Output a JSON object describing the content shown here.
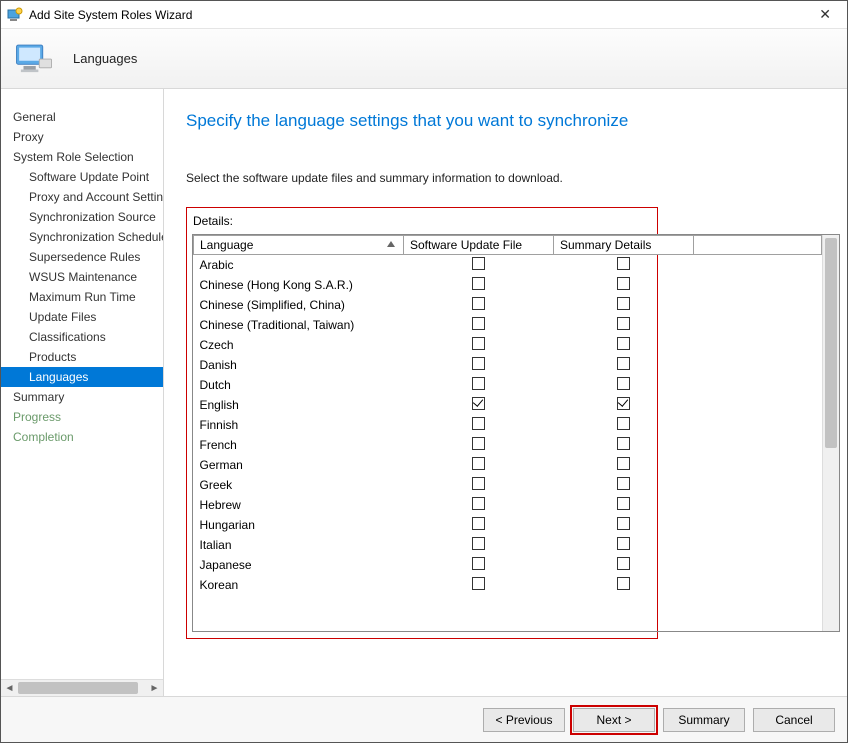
{
  "window": {
    "title": "Add Site System Roles Wizard"
  },
  "header": {
    "title": "Languages"
  },
  "sidebar": {
    "items": [
      {
        "label": "General",
        "child": false,
        "selected": false,
        "disabled": false
      },
      {
        "label": "Proxy",
        "child": false,
        "selected": false,
        "disabled": false
      },
      {
        "label": "System Role Selection",
        "child": false,
        "selected": false,
        "disabled": false
      },
      {
        "label": "Software Update Point",
        "child": true,
        "selected": false,
        "disabled": false
      },
      {
        "label": "Proxy and Account Settings",
        "child": true,
        "selected": false,
        "disabled": false
      },
      {
        "label": "Synchronization Source",
        "child": true,
        "selected": false,
        "disabled": false
      },
      {
        "label": "Synchronization Schedule",
        "child": true,
        "selected": false,
        "disabled": false
      },
      {
        "label": "Supersedence Rules",
        "child": true,
        "selected": false,
        "disabled": false
      },
      {
        "label": "WSUS Maintenance",
        "child": true,
        "selected": false,
        "disabled": false
      },
      {
        "label": "Maximum Run Time",
        "child": true,
        "selected": false,
        "disabled": false
      },
      {
        "label": "Update Files",
        "child": true,
        "selected": false,
        "disabled": false
      },
      {
        "label": "Classifications",
        "child": true,
        "selected": false,
        "disabled": false
      },
      {
        "label": "Products",
        "child": true,
        "selected": false,
        "disabled": false
      },
      {
        "label": "Languages",
        "child": true,
        "selected": true,
        "disabled": false
      },
      {
        "label": "Summary",
        "child": false,
        "selected": false,
        "disabled": false
      },
      {
        "label": "Progress",
        "child": false,
        "selected": false,
        "disabled": true
      },
      {
        "label": "Completion",
        "child": false,
        "selected": false,
        "disabled": true
      }
    ]
  },
  "page": {
    "heading": "Specify the language settings that you want to synchronize",
    "instruction": "Select the software update files and summary information to download.",
    "details_label": "Details:"
  },
  "grid": {
    "columns": {
      "language": "Language",
      "suf": "Software Update File",
      "summary": "Summary Details"
    },
    "rows": [
      {
        "language": "Arabic",
        "suf": false,
        "summary": false
      },
      {
        "language": "Chinese (Hong Kong S.A.R.)",
        "suf": false,
        "summary": false
      },
      {
        "language": "Chinese (Simplified, China)",
        "suf": false,
        "summary": false
      },
      {
        "language": "Chinese (Traditional, Taiwan)",
        "suf": false,
        "summary": false
      },
      {
        "language": "Czech",
        "suf": false,
        "summary": false
      },
      {
        "language": "Danish",
        "suf": false,
        "summary": false
      },
      {
        "language": "Dutch",
        "suf": false,
        "summary": false
      },
      {
        "language": "English",
        "suf": true,
        "summary": true
      },
      {
        "language": "Finnish",
        "suf": false,
        "summary": false
      },
      {
        "language": "French",
        "suf": false,
        "summary": false
      },
      {
        "language": "German",
        "suf": false,
        "summary": false
      },
      {
        "language": "Greek",
        "suf": false,
        "summary": false
      },
      {
        "language": "Hebrew",
        "suf": false,
        "summary": false
      },
      {
        "language": "Hungarian",
        "suf": false,
        "summary": false
      },
      {
        "language": "Italian",
        "suf": false,
        "summary": false
      },
      {
        "language": "Japanese",
        "suf": false,
        "summary": false
      },
      {
        "language": "Korean",
        "suf": false,
        "summary": false
      }
    ]
  },
  "footer": {
    "previous": "<  Previous",
    "next": "Next  >",
    "summary": "Summary",
    "cancel": "Cancel"
  }
}
